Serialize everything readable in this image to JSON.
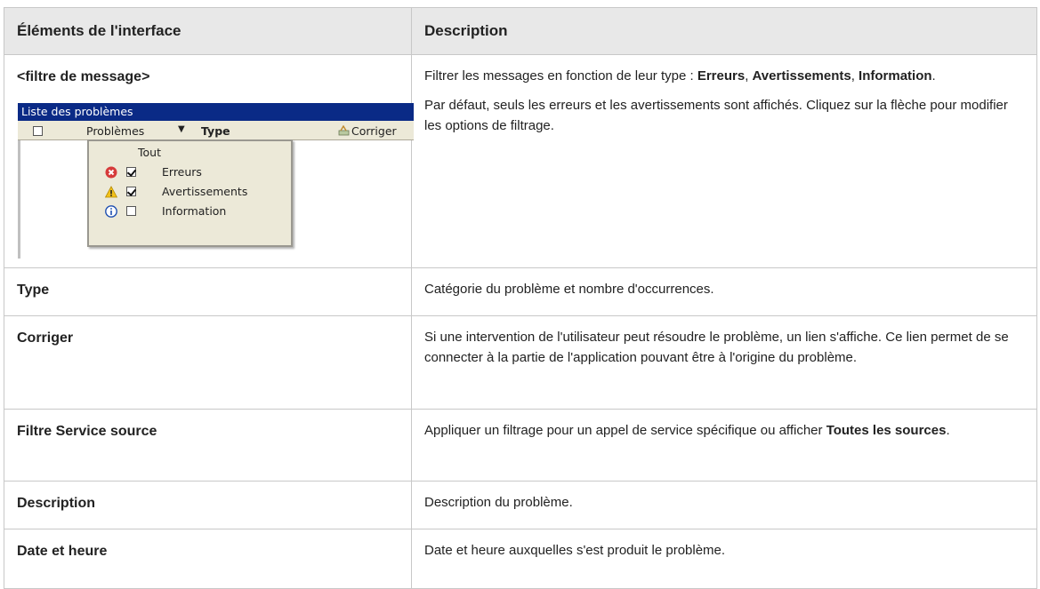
{
  "table": {
    "headers": [
      "Éléments de l'interface",
      "Description"
    ],
    "rows": {
      "filter": {
        "name": "<filtre de message>",
        "desc1_prefix": "Filtrer les messages en fonction de leur type : ",
        "desc1_b1": "Erreurs",
        "desc1_sep": ", ",
        "desc1_b2": "Avertissements",
        "desc1_sep2": ", ",
        "desc1_b3": "Information",
        "desc1_end": ".",
        "desc2": "Par défaut, seuls les erreurs et les avertissements sont affichés. Cliquez sur la flèche pour modifier les options de filtrage."
      },
      "type": {
        "name": "Type",
        "desc": "Catégorie du problème et nombre d'occurrences."
      },
      "fix": {
        "name": "Corriger",
        "desc": "Si une intervention de l'utilisateur peut résoudre le problème, un lien s'affiche. Ce lien permet de se connecter à la partie de l'application pouvant être à l'origine du problème."
      },
      "source": {
        "name": "Filtre Service source",
        "desc_prefix": "Appliquer un filtrage pour un appel de service spécifique ou afficher ",
        "desc_bold": "Toutes les sources",
        "desc_end": "."
      },
      "description": {
        "name": "Description",
        "desc": "Description du problème."
      },
      "datetime": {
        "name": "Date et heure",
        "desc": "Date et heure auxquelles s'est produit le problème."
      }
    }
  },
  "screenshot": {
    "title": "Liste des problèmes",
    "header": {
      "problems": "Problèmes",
      "arrow": "▼",
      "type": "Type",
      "fix": "Corriger"
    },
    "menu": {
      "all": "Tout",
      "items": [
        {
          "label": "Erreurs",
          "checked": true,
          "icon": "error-icon"
        },
        {
          "label": "Avertissements",
          "checked": true,
          "icon": "warning-icon"
        },
        {
          "label": "Information",
          "checked": false,
          "icon": "info-icon"
        }
      ]
    },
    "colors": {
      "titlebar": "#0a2a86",
      "panel": "#ece9d8",
      "error": "#d63b3b",
      "warning": "#f2c11b",
      "info": "#1f4fb0"
    }
  }
}
